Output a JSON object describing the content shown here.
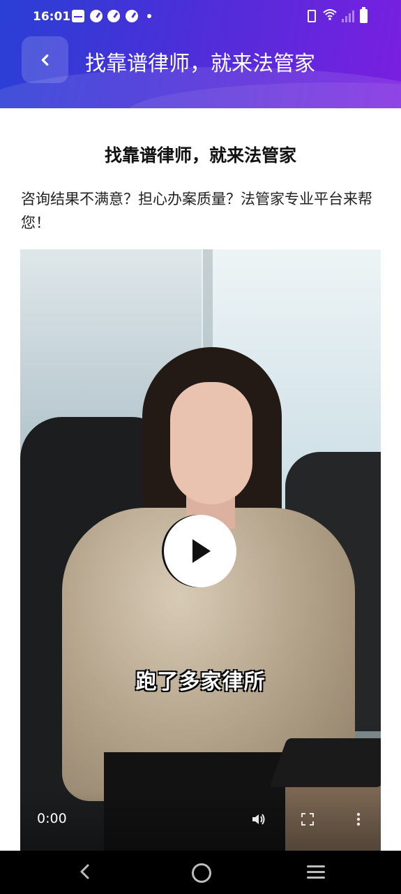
{
  "status_bar": {
    "time": "16:01"
  },
  "header": {
    "title": "找靠谱律师，就来法管家",
    "colors": {
      "gradient_start": "#2a3fd6",
      "gradient_end": "#7a1fe0"
    }
  },
  "content": {
    "title": "找靠谱律师，就来法管家",
    "intro": "咨询结果不满意？担心办案质量？法管家专业平台来帮您！"
  },
  "video": {
    "caption": "跑了多家律所",
    "current_time": "0:00"
  }
}
